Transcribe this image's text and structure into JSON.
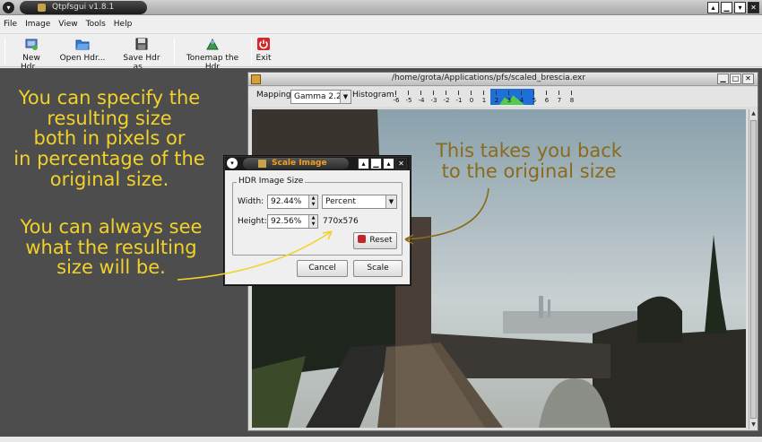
{
  "app": {
    "title": "Qtpfsgui v1.8.1"
  },
  "menubar": {
    "items": [
      "File",
      "Image",
      "View",
      "Tools",
      "Help"
    ]
  },
  "toolbar": {
    "new_hdr": "New Hdr...",
    "open_hdr": "Open Hdr...",
    "save_hdr": "Save Hdr as...",
    "tonemap": "Tonemap the Hdr",
    "exit": "Exit"
  },
  "image_window": {
    "path": "/home/grota/Applications/pfs/scaled_brescia.exr",
    "mapping_label": "Mapping:",
    "mapping_value": "Gamma 2.2",
    "histogram_label": "Histogram:",
    "histogram_ticks": [
      "-6",
      "-5",
      "-4",
      "-3",
      "-2",
      "-1",
      "0",
      "1",
      "2",
      "3",
      "4",
      "5",
      "6",
      "7",
      "8"
    ]
  },
  "dialog": {
    "title": "Scale Image",
    "group_title": "HDR Image Size",
    "width_label": "Width:",
    "width_value": "92.44%",
    "unit_value": "Percent",
    "height_label": "Height:",
    "height_value": "92.56%",
    "size_readout": "770x576",
    "reset_label": "Reset",
    "cancel_label": "Cancel",
    "scale_label": "Scale"
  },
  "annotations": {
    "size_units": [
      "You can specify the",
      "resulting size",
      "both in pixels or",
      "in percentage of the",
      "original size."
    ],
    "preview": [
      "You can always see",
      "what the resulting",
      "size will be."
    ],
    "reset": [
      "This takes you back",
      "to the original size"
    ]
  },
  "colors": {
    "workspace": "#4d4d4d",
    "annotation_yellow": "#f2d22a",
    "annotation_brown": "#8a6a1b",
    "dialog_title_accent": "#f0a020"
  }
}
